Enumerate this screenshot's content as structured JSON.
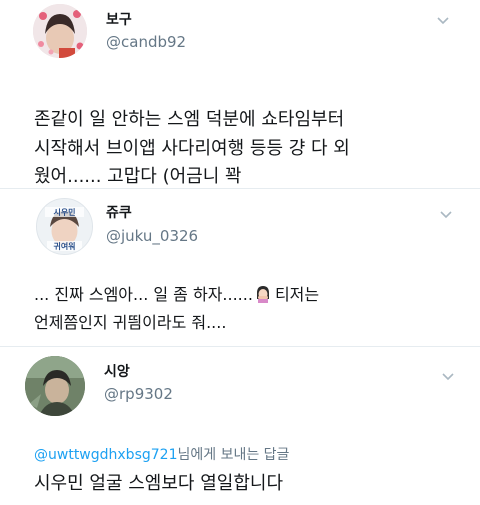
{
  "tweets": [
    {
      "name": "보구",
      "handle": "@candb92",
      "lines": [
        "존같이 일 안하는 스엠 덕분에 쇼타임부터",
        "시작해서 브이앱 사다리여행 등등 걍 다 외",
        "웠어...... 고맙다 (어금니 꽉"
      ]
    },
    {
      "name": "쥬쿠",
      "handle": "@juku_0326",
      "avatar_text": [
        "시우민",
        "귀여워"
      ],
      "lines": [
        "... 진짜 스엠아... 일 좀 하자......",
        "티저는",
        "언제쯤인지 귀띔이라도 줘...."
      ]
    },
    {
      "name": "시앙",
      "handle": "@rp9302",
      "reply_mention": "@uwttwgdhxbsg721",
      "reply_suffix": "님에게 보내는 답글",
      "lines": [
        "시우민 얼굴 스엠보다 열일합니다"
      ]
    }
  ],
  "colors": {
    "text": "#14171a",
    "secondary": "#657786",
    "link": "#1da1f2",
    "divider": "#e6ecf0"
  },
  "icons": [
    "chevron-down-icon",
    "woman-facepalming-emoji"
  ]
}
